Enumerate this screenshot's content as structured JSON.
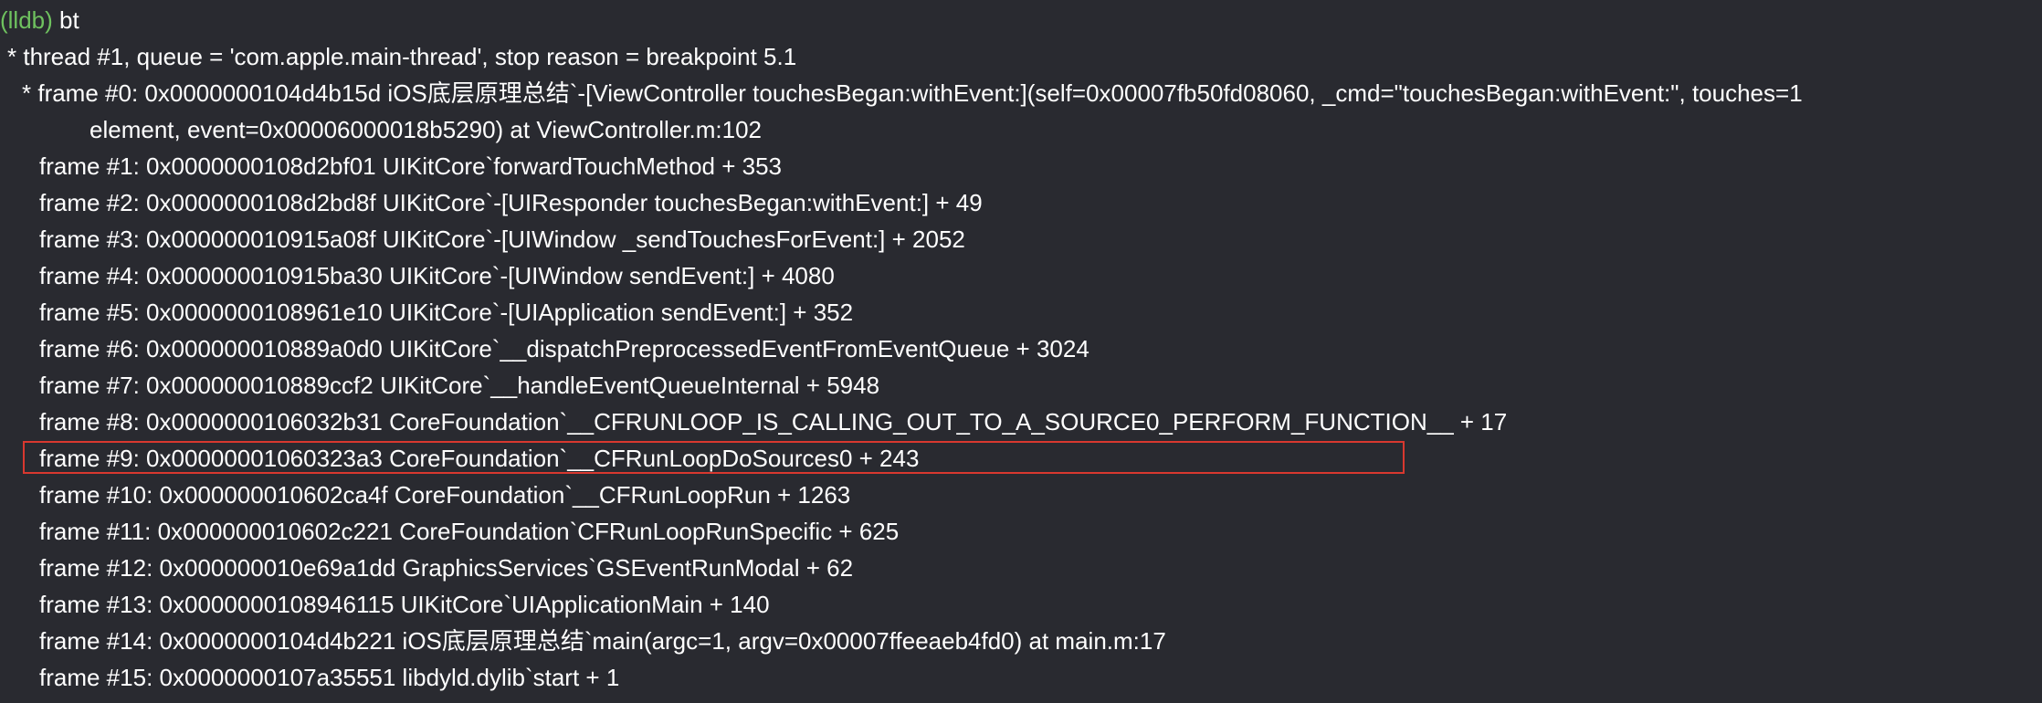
{
  "prompt": {
    "name": "(lldb)",
    "command": " bt"
  },
  "thread_line": "* thread #1, queue = 'com.apple.main-thread', stop reason = breakpoint 5.1",
  "frame0": {
    "line1": "* frame #0: 0x0000000104d4b15d iOS底层原理总结`-[ViewController touchesBegan:withEvent:](self=0x00007fb50fd08060, _cmd=\"touchesBegan:withEvent:\", touches=1",
    "line2": "element, event=0x00006000018b5290) at ViewController.m:102"
  },
  "frames": [
    "frame #1: 0x0000000108d2bf01 UIKitCore`forwardTouchMethod + 353",
    "frame #2: 0x0000000108d2bd8f UIKitCore`-[UIResponder touchesBegan:withEvent:] + 49",
    "frame #3: 0x000000010915a08f UIKitCore`-[UIWindow _sendTouchesForEvent:] + 2052",
    "frame #4: 0x000000010915ba30 UIKitCore`-[UIWindow sendEvent:] + 4080",
    "frame #5: 0x0000000108961e10 UIKitCore`-[UIApplication sendEvent:] + 352",
    "frame #6: 0x000000010889a0d0 UIKitCore`__dispatchPreprocessedEventFromEventQueue + 3024",
    "frame #7: 0x000000010889ccf2 UIKitCore`__handleEventQueueInternal + 5948",
    "frame #8: 0x0000000106032b31 CoreFoundation`__CFRUNLOOP_IS_CALLING_OUT_TO_A_SOURCE0_PERFORM_FUNCTION__ + 17",
    "frame #9: 0x00000001060323a3 CoreFoundation`__CFRunLoopDoSources0 + 243",
    "frame #10: 0x000000010602ca4f CoreFoundation`__CFRunLoopRun + 1263",
    "frame #11: 0x000000010602c221 CoreFoundation`CFRunLoopRunSpecific + 625",
    "frame #12: 0x000000010e69a1dd GraphicsServices`GSEventRunModal + 62",
    "frame #13: 0x0000000108946115 UIKitCore`UIApplicationMain + 140",
    "frame #14: 0x0000000104d4b221 iOS底层原理总结`main(argc=1, argv=0x00007ffeeaeb4fd0) at main.m:17",
    "frame #15: 0x0000000107a35551 libdyld.dylib`start + 1"
  ],
  "colors": {
    "background": "#292a30",
    "text": "#ffffff",
    "prompt": "#6fc25f",
    "highlight": "#d8382f"
  }
}
